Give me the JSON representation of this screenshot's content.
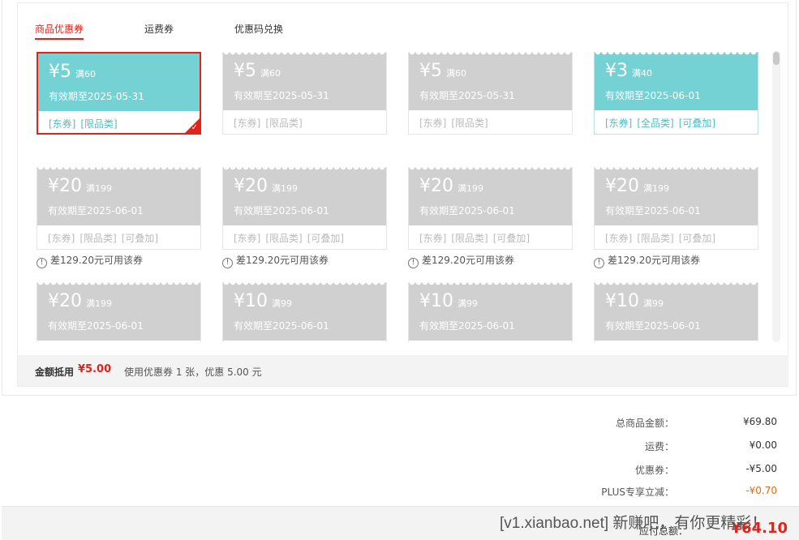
{
  "tabs": [
    {
      "label": "商品优惠券",
      "active": true
    },
    {
      "label": "运费券",
      "active": false
    },
    {
      "label": "优惠码兑换",
      "active": false
    }
  ],
  "coupons": [
    {
      "price": "¥5",
      "cond": "满60",
      "expiry": "有效期至2025-05-31",
      "tags": [
        "[东券]",
        "[限品类]"
      ],
      "state": "selected"
    },
    {
      "price": "¥5",
      "cond": "满60",
      "expiry": "有效期至2025-05-31",
      "tags": [
        "[东券]",
        "[限品类]"
      ],
      "state": "disabled"
    },
    {
      "price": "¥5",
      "cond": "满60",
      "expiry": "有效期至2025-05-31",
      "tags": [
        "[东券]",
        "[限品类]"
      ],
      "state": "disabled"
    },
    {
      "price": "¥3",
      "cond": "满40",
      "expiry": "有效期至2025-06-01",
      "tags": [
        "[东券]",
        "[全品类]",
        "[可叠加]"
      ],
      "state": "available"
    },
    {
      "price": "¥20",
      "cond": "满199",
      "expiry": "有效期至2025-06-01",
      "tags": [
        "[东券]",
        "[限品类]",
        "[可叠加]"
      ],
      "state": "disabled",
      "notice": "差129.20元可用该券"
    },
    {
      "price": "¥20",
      "cond": "满199",
      "expiry": "有效期至2025-06-01",
      "tags": [
        "[东券]",
        "[限品类]",
        "[可叠加]"
      ],
      "state": "disabled",
      "notice": "差129.20元可用该券"
    },
    {
      "price": "¥20",
      "cond": "满199",
      "expiry": "有效期至2025-06-01",
      "tags": [
        "[东券]",
        "[限品类]",
        "[可叠加]"
      ],
      "state": "disabled",
      "notice": "差129.20元可用该券"
    },
    {
      "price": "¥20",
      "cond": "满199",
      "expiry": "有效期至2025-06-01",
      "tags": [
        "[东券]",
        "[限品类]",
        "[可叠加]"
      ],
      "state": "disabled",
      "notice": "差129.20元可用该券"
    },
    {
      "price": "¥20",
      "cond": "满199",
      "expiry": "有效期至2025-06-01",
      "tags": [],
      "state": "disabled"
    },
    {
      "price": "¥10",
      "cond": "满99",
      "expiry": "有效期至2025-06-01",
      "tags": [],
      "state": "disabled"
    },
    {
      "price": "¥10",
      "cond": "满99",
      "expiry": "有效期至2025-06-01",
      "tags": [],
      "state": "disabled"
    },
    {
      "price": "¥10",
      "cond": "满99",
      "expiry": "有效期至2025-06-01",
      "tags": [],
      "state": "disabled"
    }
  ],
  "summary": {
    "label": "金额抵用",
    "amount": "¥5.00",
    "desc": "使用优惠券 1 张，优惠 5.00 元"
  },
  "totals": [
    {
      "label": "总商品金额：",
      "value": "¥69.80",
      "highlight": false
    },
    {
      "label": "运费：",
      "value": "¥0.00",
      "highlight": false
    },
    {
      "label": "优惠券：",
      "value": "-¥5.00",
      "highlight": false
    },
    {
      "label": "PLUS专享立减：",
      "value": "-¥0.70",
      "highlight": true
    }
  ],
  "payment": {
    "label": "应付总额：",
    "value": "¥64.10"
  },
  "watermark": "[v1.xianbao.net] 新赚吧，有你更精彩！",
  "icons": {
    "check": "check-icon",
    "info": "info-icon"
  },
  "colors": {
    "accent": "#e2231a",
    "teal": "#74d2d5",
    "disabled": "#d0d0d0",
    "plus": "#e26a1a"
  }
}
